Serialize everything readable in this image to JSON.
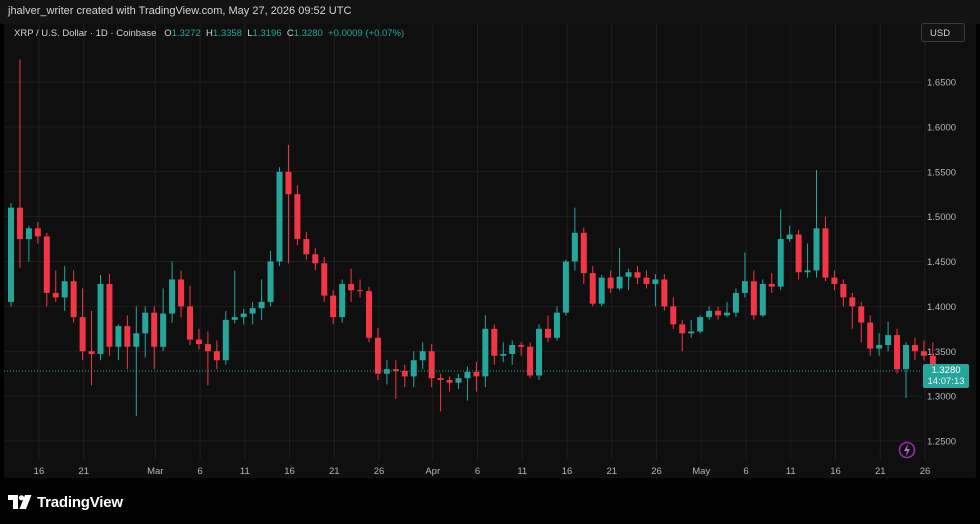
{
  "credit": "jhalver_writer created with TradingView.com, May 27, 2026 09:52 UTC",
  "legend": {
    "symbol": "XRP / U.S. Dollar · 1D · Coinbase",
    "open_label": "O",
    "open": "1.3272",
    "high_label": "H",
    "high": "1.3358",
    "low_label": "L",
    "low": "1.3196",
    "close_label": "C",
    "close": "1.3280",
    "change": "+0.0009 (+0.07%)"
  },
  "currency": "USD",
  "price_tag": {
    "price": "1.3280",
    "countdown": "14:07:13"
  },
  "brand": "TradingView",
  "icons": {
    "logo": "tradingview-logo-icon",
    "snapshot": "snapshot-icon"
  },
  "colors": {
    "up": "#26a69a",
    "down": "#f23645",
    "background": "#0f0f0f",
    "grid": "#1f1f1f"
  },
  "chart_data": {
    "type": "candlestick",
    "title": "",
    "ylim": [
      1.23,
      1.68
    ],
    "y_ticks": [
      "1.6500",
      "1.6000",
      "1.5500",
      "1.5000",
      "1.4500",
      "1.4000",
      "1.3500",
      "1.3000",
      "1.2500"
    ],
    "x_ticks": [
      {
        "label": "16",
        "i": 1
      },
      {
        "label": "21",
        "i": 6
      },
      {
        "label": "Mar",
        "i": 14
      },
      {
        "label": "6",
        "i": 19
      },
      {
        "label": "11",
        "i": 24
      },
      {
        "label": "16",
        "i": 29
      },
      {
        "label": "21",
        "i": 34
      },
      {
        "label": "26",
        "i": 39
      },
      {
        "label": "Apr",
        "i": 45
      },
      {
        "label": "6",
        "i": 50
      },
      {
        "label": "11",
        "i": 55
      },
      {
        "label": "16",
        "i": 60
      },
      {
        "label": "21",
        "i": 65
      },
      {
        "label": "26",
        "i": 70
      },
      {
        "label": "May",
        "i": 75
      },
      {
        "label": "6",
        "i": 80
      },
      {
        "label": "11",
        "i": 85
      },
      {
        "label": "16",
        "i": 90
      },
      {
        "label": "21",
        "i": 95
      },
      {
        "label": "26",
        "i": 100
      }
    ],
    "candles": [
      {
        "o": 1.405,
        "h": 1.515,
        "l": 1.4,
        "c": 1.51
      },
      {
        "o": 1.51,
        "h": 1.675,
        "l": 1.443,
        "c": 1.475
      },
      {
        "o": 1.475,
        "h": 1.49,
        "l": 1.45,
        "c": 1.487
      },
      {
        "o": 1.487,
        "h": 1.494,
        "l": 1.47,
        "c": 1.478
      },
      {
        "o": 1.478,
        "h": 1.482,
        "l": 1.4,
        "c": 1.415
      },
      {
        "o": 1.415,
        "h": 1.44,
        "l": 1.405,
        "c": 1.41
      },
      {
        "o": 1.41,
        "h": 1.445,
        "l": 1.395,
        "c": 1.428
      },
      {
        "o": 1.428,
        "h": 1.44,
        "l": 1.382,
        "c": 1.388
      },
      {
        "o": 1.388,
        "h": 1.42,
        "l": 1.34,
        "c": 1.35
      },
      {
        "o": 1.35,
        "h": 1.395,
        "l": 1.312,
        "c": 1.347
      },
      {
        "o": 1.347,
        "h": 1.435,
        "l": 1.34,
        "c": 1.425
      },
      {
        "o": 1.425,
        "h": 1.436,
        "l": 1.345,
        "c": 1.355
      },
      {
        "o": 1.355,
        "h": 1.38,
        "l": 1.34,
        "c": 1.378
      },
      {
        "o": 1.378,
        "h": 1.39,
        "l": 1.33,
        "c": 1.355
      },
      {
        "o": 1.355,
        "h": 1.4,
        "l": 1.278,
        "c": 1.37
      },
      {
        "o": 1.37,
        "h": 1.4,
        "l": 1.343,
        "c": 1.393
      },
      {
        "o": 1.393,
        "h": 1.4,
        "l": 1.33,
        "c": 1.355
      },
      {
        "o": 1.355,
        "h": 1.42,
        "l": 1.35,
        "c": 1.392
      },
      {
        "o": 1.392,
        "h": 1.45,
        "l": 1.382,
        "c": 1.43
      },
      {
        "o": 1.43,
        "h": 1.44,
        "l": 1.388,
        "c": 1.4
      },
      {
        "o": 1.4,
        "h": 1.423,
        "l": 1.357,
        "c": 1.363
      },
      {
        "o": 1.363,
        "h": 1.375,
        "l": 1.352,
        "c": 1.358
      },
      {
        "o": 1.358,
        "h": 1.372,
        "l": 1.312,
        "c": 1.35
      },
      {
        "o": 1.35,
        "h": 1.362,
        "l": 1.33,
        "c": 1.34
      },
      {
        "o": 1.34,
        "h": 1.395,
        "l": 1.335,
        "c": 1.385
      },
      {
        "o": 1.385,
        "h": 1.44,
        "l": 1.381,
        "c": 1.388
      },
      {
        "o": 1.388,
        "h": 1.397,
        "l": 1.38,
        "c": 1.392
      },
      {
        "o": 1.392,
        "h": 1.405,
        "l": 1.38,
        "c": 1.398
      },
      {
        "o": 1.398,
        "h": 1.43,
        "l": 1.385,
        "c": 1.405
      },
      {
        "o": 1.405,
        "h": 1.462,
        "l": 1.4,
        "c": 1.45
      },
      {
        "o": 1.45,
        "h": 1.555,
        "l": 1.445,
        "c": 1.55
      },
      {
        "o": 1.55,
        "h": 1.58,
        "l": 1.448,
        "c": 1.525
      },
      {
        "o": 1.525,
        "h": 1.535,
        "l": 1.468,
        "c": 1.475
      },
      {
        "o": 1.475,
        "h": 1.483,
        "l": 1.452,
        "c": 1.458
      },
      {
        "o": 1.458,
        "h": 1.465,
        "l": 1.44,
        "c": 1.448
      },
      {
        "o": 1.448,
        "h": 1.455,
        "l": 1.405,
        "c": 1.412
      },
      {
        "o": 1.412,
        "h": 1.418,
        "l": 1.38,
        "c": 1.388
      },
      {
        "o": 1.388,
        "h": 1.43,
        "l": 1.382,
        "c": 1.425
      },
      {
        "o": 1.425,
        "h": 1.442,
        "l": 1.405,
        "c": 1.418
      },
      {
        "o": 1.418,
        "h": 1.43,
        "l": 1.41,
        "c": 1.417
      },
      {
        "o": 1.417,
        "h": 1.422,
        "l": 1.36,
        "c": 1.365
      },
      {
        "o": 1.365,
        "h": 1.376,
        "l": 1.318,
        "c": 1.325
      },
      {
        "o": 1.325,
        "h": 1.34,
        "l": 1.313,
        "c": 1.33
      },
      {
        "o": 1.33,
        "h": 1.34,
        "l": 1.297,
        "c": 1.328
      },
      {
        "o": 1.328,
        "h": 1.335,
        "l": 1.31,
        "c": 1.322
      },
      {
        "o": 1.322,
        "h": 1.35,
        "l": 1.31,
        "c": 1.34
      },
      {
        "o": 1.34,
        "h": 1.36,
        "l": 1.33,
        "c": 1.35
      },
      {
        "o": 1.35,
        "h": 1.358,
        "l": 1.31,
        "c": 1.32
      },
      {
        "o": 1.32,
        "h": 1.325,
        "l": 1.283,
        "c": 1.318
      },
      {
        "o": 1.318,
        "h": 1.322,
        "l": 1.305,
        "c": 1.315
      },
      {
        "o": 1.315,
        "h": 1.325,
        "l": 1.308,
        "c": 1.32
      },
      {
        "o": 1.32,
        "h": 1.333,
        "l": 1.295,
        "c": 1.327
      },
      {
        "o": 1.327,
        "h": 1.338,
        "l": 1.305,
        "c": 1.322
      },
      {
        "o": 1.322,
        "h": 1.39,
        "l": 1.31,
        "c": 1.375
      },
      {
        "o": 1.375,
        "h": 1.38,
        "l": 1.335,
        "c": 1.345
      },
      {
        "o": 1.345,
        "h": 1.36,
        "l": 1.338,
        "c": 1.347
      },
      {
        "o": 1.347,
        "h": 1.362,
        "l": 1.335,
        "c": 1.357
      },
      {
        "o": 1.357,
        "h": 1.36,
        "l": 1.345,
        "c": 1.355
      },
      {
        "o": 1.355,
        "h": 1.36,
        "l": 1.32,
        "c": 1.323
      },
      {
        "o": 1.323,
        "h": 1.38,
        "l": 1.318,
        "c": 1.375
      },
      {
        "o": 1.375,
        "h": 1.39,
        "l": 1.36,
        "c": 1.365
      },
      {
        "o": 1.365,
        "h": 1.4,
        "l": 1.362,
        "c": 1.393
      },
      {
        "o": 1.393,
        "h": 1.452,
        "l": 1.39,
        "c": 1.45
      },
      {
        "o": 1.45,
        "h": 1.51,
        "l": 1.44,
        "c": 1.482
      },
      {
        "o": 1.482,
        "h": 1.488,
        "l": 1.425,
        "c": 1.437
      },
      {
        "o": 1.437,
        "h": 1.445,
        "l": 1.4,
        "c": 1.403
      },
      {
        "o": 1.403,
        "h": 1.435,
        "l": 1.4,
        "c": 1.432
      },
      {
        "o": 1.432,
        "h": 1.44,
        "l": 1.415,
        "c": 1.42
      },
      {
        "o": 1.42,
        "h": 1.465,
        "l": 1.418,
        "c": 1.433
      },
      {
        "o": 1.433,
        "h": 1.442,
        "l": 1.418,
        "c": 1.438
      },
      {
        "o": 1.438,
        "h": 1.445,
        "l": 1.425,
        "c": 1.432
      },
      {
        "o": 1.432,
        "h": 1.44,
        "l": 1.42,
        "c": 1.425
      },
      {
        "o": 1.425,
        "h": 1.436,
        "l": 1.4,
        "c": 1.43
      },
      {
        "o": 1.43,
        "h": 1.436,
        "l": 1.395,
        "c": 1.4
      },
      {
        "o": 1.4,
        "h": 1.41,
        "l": 1.375,
        "c": 1.38
      },
      {
        "o": 1.38,
        "h": 1.385,
        "l": 1.35,
        "c": 1.37
      },
      {
        "o": 1.37,
        "h": 1.385,
        "l": 1.365,
        "c": 1.372
      },
      {
        "o": 1.372,
        "h": 1.39,
        "l": 1.37,
        "c": 1.388
      },
      {
        "o": 1.388,
        "h": 1.4,
        "l": 1.385,
        "c": 1.395
      },
      {
        "o": 1.395,
        "h": 1.4,
        "l": 1.385,
        "c": 1.39
      },
      {
        "o": 1.39,
        "h": 1.405,
        "l": 1.388,
        "c": 1.393
      },
      {
        "o": 1.393,
        "h": 1.42,
        "l": 1.388,
        "c": 1.415
      },
      {
        "o": 1.415,
        "h": 1.46,
        "l": 1.41,
        "c": 1.428
      },
      {
        "o": 1.428,
        "h": 1.44,
        "l": 1.385,
        "c": 1.39
      },
      {
        "o": 1.39,
        "h": 1.43,
        "l": 1.388,
        "c": 1.425
      },
      {
        "o": 1.425,
        "h": 1.437,
        "l": 1.415,
        "c": 1.422
      },
      {
        "o": 1.422,
        "h": 1.508,
        "l": 1.418,
        "c": 1.475
      },
      {
        "o": 1.475,
        "h": 1.49,
        "l": 1.472,
        "c": 1.48
      },
      {
        "o": 1.48,
        "h": 1.485,
        "l": 1.43,
        "c": 1.438
      },
      {
        "o": 1.438,
        "h": 1.47,
        "l": 1.432,
        "c": 1.44
      },
      {
        "o": 1.44,
        "h": 1.552,
        "l": 1.432,
        "c": 1.487
      },
      {
        "o": 1.487,
        "h": 1.5,
        "l": 1.428,
        "c": 1.432
      },
      {
        "o": 1.432,
        "h": 1.44,
        "l": 1.418,
        "c": 1.425
      },
      {
        "o": 1.425,
        "h": 1.43,
        "l": 1.4,
        "c": 1.41
      },
      {
        "o": 1.41,
        "h": 1.415,
        "l": 1.375,
        "c": 1.4
      },
      {
        "o": 1.4,
        "h": 1.405,
        "l": 1.36,
        "c": 1.382
      },
      {
        "o": 1.382,
        "h": 1.39,
        "l": 1.345,
        "c": 1.353
      },
      {
        "o": 1.353,
        "h": 1.37,
        "l": 1.345,
        "c": 1.357
      },
      {
        "o": 1.357,
        "h": 1.383,
        "l": 1.35,
        "c": 1.368
      },
      {
        "o": 1.368,
        "h": 1.375,
        "l": 1.325,
        "c": 1.33
      },
      {
        "o": 1.33,
        "h": 1.36,
        "l": 1.298,
        "c": 1.357
      },
      {
        "o": 1.357,
        "h": 1.365,
        "l": 1.34,
        "c": 1.35
      },
      {
        "o": 1.35,
        "h": 1.362,
        "l": 1.34,
        "c": 1.345
      },
      {
        "o": 1.345,
        "h": 1.36,
        "l": 1.32,
        "c": 1.327
      },
      {
        "o": 1.327,
        "h": 1.336,
        "l": 1.32,
        "c": 1.328
      }
    ]
  }
}
